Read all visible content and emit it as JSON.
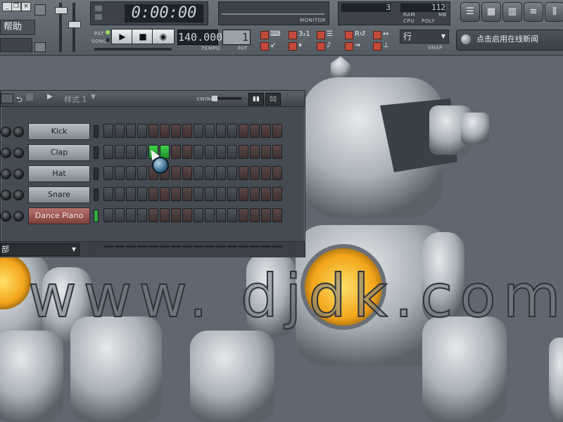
{
  "window_buttons": [
    "_",
    "❐",
    "×"
  ],
  "menu": {
    "help": "帮助"
  },
  "transport": {
    "time": "0:00:00",
    "tempo": "140.000",
    "tempo_label": "TEMPO",
    "pat_label": "PAT",
    "song_label": "SONG",
    "pattern_label": "PAT",
    "play_icon": "play-icon",
    "stop_icon": "stop-icon",
    "record_icon": "record-icon"
  },
  "monitor": {
    "label": "MONITOR"
  },
  "status": {
    "left_value": "3",
    "right_value": "112",
    "ram_label": "RAM",
    "mb_label": "MB",
    "cpu_label": "CPU",
    "poly_label": "POLY"
  },
  "snap": {
    "value": "行",
    "label": "SNAP"
  },
  "news": {
    "label": "点击启用在线新闻"
  },
  "sequencer": {
    "pattern_title": "样式 1",
    "swing_label": "SWING",
    "bottom_select": "部",
    "channels": [
      {
        "name": "Kick",
        "selected": false,
        "led_on": false,
        "active_steps": []
      },
      {
        "name": "Clap",
        "selected": false,
        "led_on": false,
        "active_steps": [
          4,
          5
        ]
      },
      {
        "name": "Hat",
        "selected": false,
        "led_on": false,
        "active_steps": []
      },
      {
        "name": "Snare",
        "selected": false,
        "led_on": false,
        "active_steps": []
      },
      {
        "name": "Dance Piano",
        "selected": true,
        "led_on": true,
        "active_steps": []
      }
    ],
    "step_count": 16
  },
  "watermark": "www. djdk.com",
  "colors": {
    "step_on": "#2fae3c",
    "channel_selected": "#9a5852",
    "record_button": "#c24a3a"
  }
}
